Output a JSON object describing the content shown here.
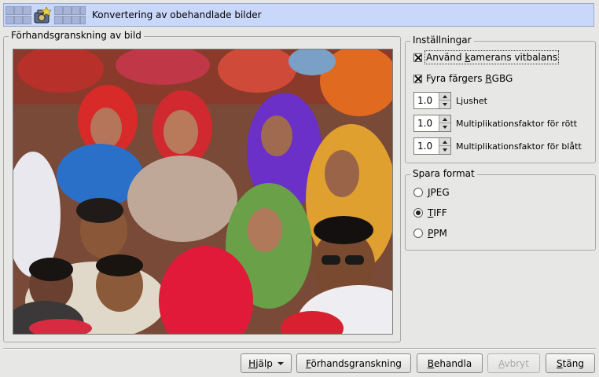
{
  "header": {
    "title": "Konvertering av obehandlade bilder",
    "icon_left": "grid-icon",
    "icon_app": "camera-icon",
    "icon_right": "grid-icon"
  },
  "preview": {
    "title": "Förhandsgranskning av bild",
    "image": "photo-preview"
  },
  "settings": {
    "title": "Inställningar",
    "checkboxes": [
      {
        "pre": "Använd ",
        "mn": "k",
        "post": "amerans vitbalans",
        "checked": true
      },
      {
        "pre": "Fyra färgers ",
        "mn": "R",
        "post": "GBG",
        "checked": true
      }
    ],
    "spins": [
      {
        "value": "1.0",
        "label": "Ljushet"
      },
      {
        "value": "1.0",
        "label": "Multiplikationsfaktor för rött"
      },
      {
        "value": "1.0",
        "label": "Multiplikationsfaktor för blått"
      }
    ]
  },
  "format": {
    "title": "Spara format",
    "options": [
      {
        "mn": "J",
        "post": "PEG",
        "checked": false
      },
      {
        "mn": "T",
        "post": "IFF",
        "checked": true
      },
      {
        "mn": "P",
        "post": "PM",
        "checked": false
      }
    ]
  },
  "buttons": {
    "help": {
      "mn": "H",
      "post": "jälp"
    },
    "preview": {
      "mn": "F",
      "post": "örhandsgranskning"
    },
    "process": {
      "mn": "B",
      "post": "ehandla"
    },
    "abort": {
      "mn": "A",
      "post": "vbryt"
    },
    "close": {
      "mn": "S",
      "post": "täng"
    }
  }
}
